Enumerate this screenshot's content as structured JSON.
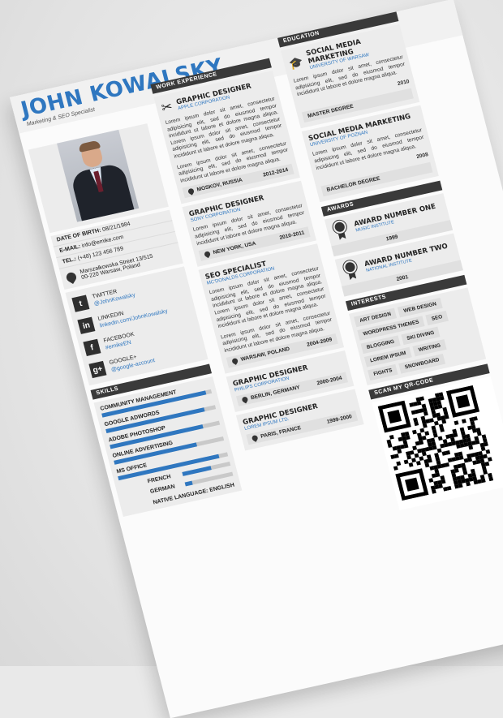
{
  "header": {
    "name": "JOHN KOWALSKY",
    "subtitle": "Marketing & SEO Specialist"
  },
  "personal": {
    "dob_label": "DATE OF BIRTH:",
    "dob": "08/21/1984",
    "email_label": "E-MAIL:",
    "email": "info@emike.com",
    "tel_label": "TEL.:",
    "tel": "(+48) 123 456 789",
    "address_line1": "Marszałkowska Street  13/515",
    "address_line2": "00-220 Warsaw, Poland"
  },
  "social": [
    {
      "icon": "twitter-icon",
      "glyph": "t",
      "name": "TWITTER",
      "handle": "@JohnKowalsky"
    },
    {
      "icon": "linkedin-icon",
      "glyph": "in",
      "name": "LINKEDIN",
      "handle": "linkedin.com/JohnKowalsky"
    },
    {
      "icon": "facebook-icon",
      "glyph": "f",
      "name": "FACEBOOK",
      "handle": "#emikeEN"
    },
    {
      "icon": "googleplus-icon",
      "glyph": "g+",
      "name": "GOOGLE+",
      "handle": "@google-account"
    }
  ],
  "skills": {
    "section_label": "SKILLS",
    "items": [
      {
        "name": "COMMUNITY MANAGEMENT",
        "level": 0.95
      },
      {
        "name": "GOOGLE ADWORDS",
        "level": 0.9
      },
      {
        "name": "ADOBE PHOTOSHOP",
        "level": 0.85
      },
      {
        "name": "ONLINE ADVERTISING",
        "level": 0.75
      },
      {
        "name": "MS OFFICE",
        "level": 0.92
      }
    ],
    "languages": [
      {
        "name": "FRENCH",
        "level": 0.6
      },
      {
        "name": "GERMAN",
        "level": 0.15
      }
    ],
    "native": "NATIVE LANGUAGE: ENGLISH"
  },
  "experience": {
    "section_label": "WORK EXPERIENCE",
    "lorem_a": "Lorem ipsum dolor sit amet, consectetur adipisicing elit, sed do eiusmod tempor incididunt ut labore et dolore magna aliqua. Lorem ipsum dolor sit amet, consectetur adipisicing elit, sed do eiusmod tempor incididunt ut labore et dolore magna aliqua.",
    "lorem_b": "Lorem ipsum dolor sit amet, consectetur adipisicing elit, sed do eiusmod tempor incididunt ut labore et dolore magna aliqua.",
    "jobs": [
      {
        "title": "GRAPHIC DESIGNER",
        "company": "APPLE CORPORATION",
        "location": "MOSKOV, RUSSIA",
        "years": "2012-2014"
      },
      {
        "title": "GRAPHIC DESIGNER",
        "company": "SONY CORPORATION",
        "location": "NEW YORK, USA",
        "years": "2010-2011"
      },
      {
        "title": "SEO SPECIALIST",
        "company": "MC'DONALDS CORPORATION",
        "location": "WARSAW, POLAND",
        "years": "2004-2009"
      },
      {
        "title": "GRAPHIC DESIGNER",
        "company": "PHILIPS CORPORATION",
        "location": "BERLIN, GERMANY",
        "years": "2000-2004"
      },
      {
        "title": "GRAPHIC DESIGNER",
        "company": "LOREM IPSUM LTD.",
        "location": "PARIS, FRANCE",
        "years": "1999-2000"
      }
    ]
  },
  "education": {
    "section_label": "EDUCATION",
    "lorem": "Lorem ipsum dolor sit amet, consectetur adipisicing elit, sed do eiusmod tempor incididunt ut labore et dolore magna aliqua.",
    "items": [
      {
        "title": "SOCIAL MEDIA MARKETING",
        "school": "UNIVERSITY OF WARSAW",
        "year": "2010",
        "degree": "MASTER DEGREE"
      },
      {
        "title": "SOCIAL MEDIA MARKETING",
        "school": "UNIVERSITY OF POZNAN",
        "year": "2008",
        "degree": "BACHELOR DEGREE"
      }
    ]
  },
  "awards": {
    "section_label": "AWARDS",
    "items": [
      {
        "title": "AWARD NUMBER ONE",
        "sub": "MUSIC INSTITUTE",
        "year": "1999"
      },
      {
        "title": "AWARD NUMBER TWO",
        "sub": "NATIONAL INSTITUTE",
        "year": "2001"
      }
    ]
  },
  "interests": {
    "section_label": "INTERESTS",
    "items": [
      "ART DESIGN",
      "WEB DESIGN",
      "WORDPRESS THEMES",
      "SEO",
      "BLOGGING",
      "SKI DIVING",
      "LOREM IPSUM",
      "WRITING",
      "FIGHTS",
      "SNOWBOARD"
    ]
  },
  "qr": {
    "section_label": "SCAN MY QR-CODE"
  },
  "colors": {
    "accent": "#2f77c0",
    "dark": "#3a3a3a",
    "panel": "#ececec"
  }
}
